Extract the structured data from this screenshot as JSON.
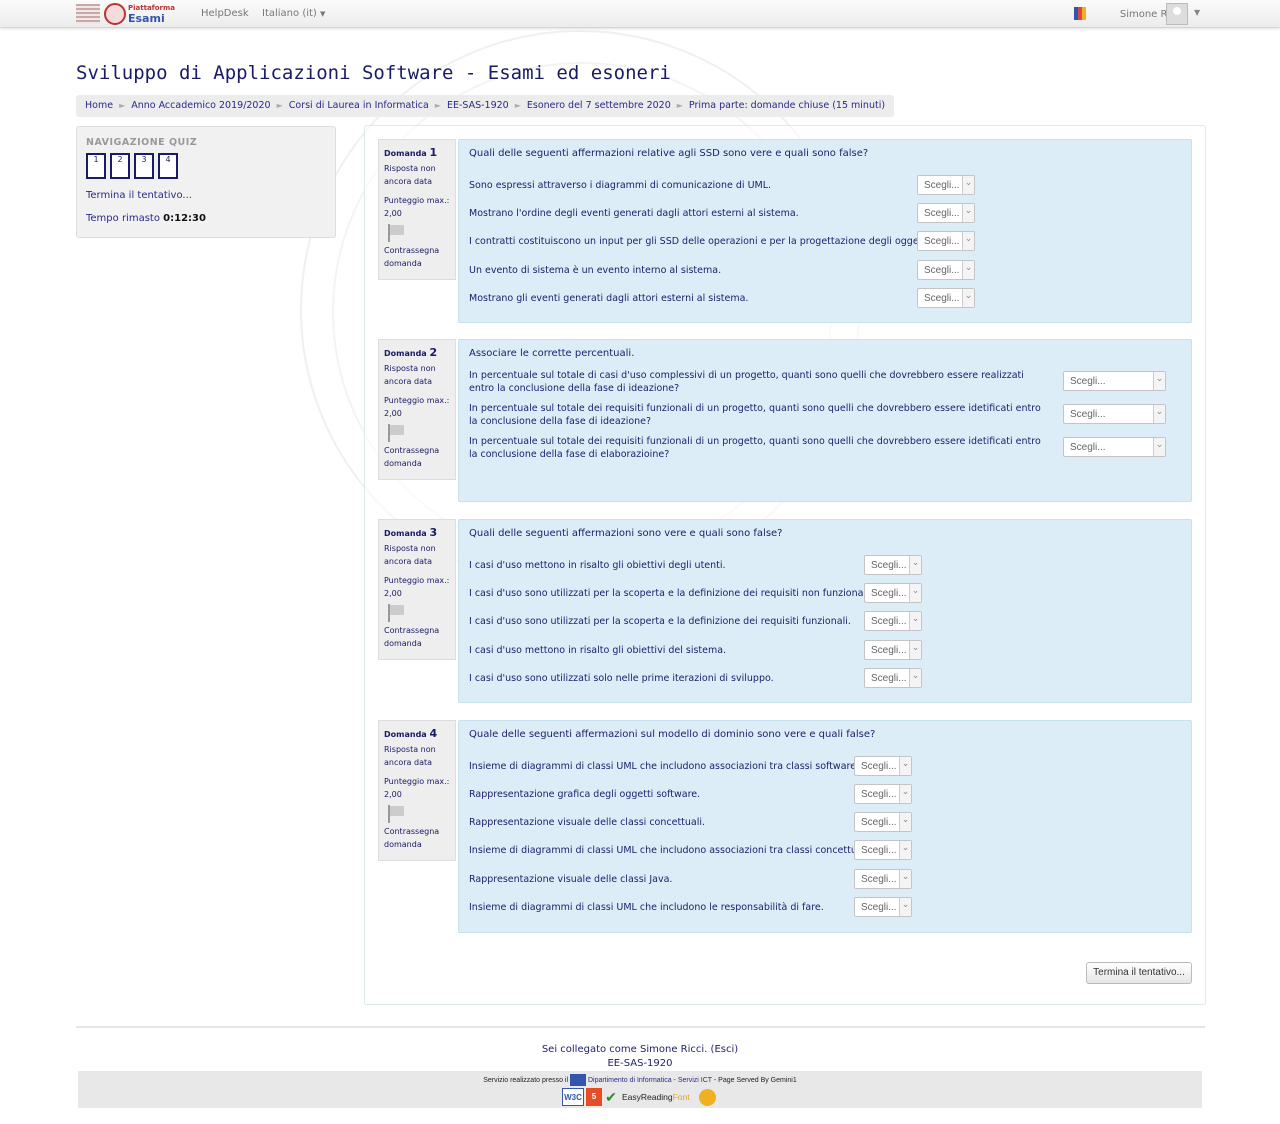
{
  "topbar": {
    "logo_line1": "Piattaforma",
    "logo_line2": "Esami",
    "helpdesk": "HelpDesk",
    "language": "Italiano (it)",
    "user_name": "Simone Ricci"
  },
  "page": {
    "title": "Sviluppo di Applicazioni Software - Esami ed esoneri"
  },
  "breadcrumb": [
    "Home",
    "Anno Accademico 2019/2020",
    "Corsi di Laurea in Informatica",
    "EE-SAS-1920",
    "Esonero del 7 settembre 2020",
    "Prima parte: domande chiuse (15 minuti)"
  ],
  "quiz_nav": {
    "heading": "NAVIGAZIONE QUIZ",
    "buttons": [
      "1",
      "2",
      "3",
      "4"
    ],
    "finish_link": "Termina il tentativo...",
    "time_label": "Tempo rimasto",
    "time_value": "0:12:30"
  },
  "question_info": {
    "label": "Domanda",
    "status": "Risposta non ancora data",
    "score_label": "Punteggio max.:",
    "score": "2,00",
    "flag_label": "Contrassegna domanda"
  },
  "select_placeholder": "Scegli...",
  "questions": [
    {
      "number": "1",
      "text": "Quali delle seguenti affermazioni relative agli SSD sono vere e quali sono false?",
      "rows": [
        "Sono espressi attraverso i diagrammi di comunicazione di UML.",
        "Mostrano l'ordine degli eventi generati dagli attori esterni al sistema.",
        "I contratti costituiscono un input per gli SSD delle operazioni e per la progettazione degli oggetti.",
        "Un evento di sistema è un evento interno al sistema.",
        "Mostrano gli eventi generati dagli attori esterni al sistema."
      ]
    },
    {
      "number": "2",
      "text": "Associare le corrette percentuali.",
      "rows": [
        "In percentuale sul totale di casi d'uso complessivi di un progetto, quanti sono quelli che dovrebbero essere realizzati entro la conclusione della fase di ideazione?",
        "In percentuale sul totale dei requisiti funzionali di un progetto, quanti sono quelli che dovrebbero essere idetificati entro la conclusione della fase di ideazione?",
        "In percentuale sul totale dei requisiti funzionali di un progetto, quanti sono quelli che dovrebbero essere idetificati entro la conclusione della fase di elaborazioine?"
      ]
    },
    {
      "number": "3",
      "text": "Quali delle seguenti affermazioni sono vere e quali sono false?",
      "rows": [
        "I casi d'uso mettono in risalto gli obiettivi degli utenti.",
        "I casi d'uso sono utilizzati per la scoperta e la definizione dei requisiti non funzionali.",
        "I casi d'uso sono utilizzati per la scoperta e la definizione dei requisiti funzionali.",
        "I casi d'uso mettono in risalto gli obiettivi del sistema.",
        "I casi d'uso sono utilizzati solo nelle prime iterazioni di sviluppo."
      ]
    },
    {
      "number": "4",
      "text": "Quale delle seguenti affermazioni sul modello di dominio sono vere e quali false?",
      "rows": [
        "Insieme di diagrammi di classi UML che includono associazioni tra classi software.",
        "Rappresentazione grafica degli oggetti software.",
        "Rappresentazione visuale delle classi concettuali.",
        "Insieme di diagrammi di classi UML che includono associazioni tra classi concettuali.",
        "Rappresentazione visuale delle classi Java.",
        "Insieme di diagrammi di classi UML che includono le responsabilità di fare."
      ]
    }
  ],
  "finish_button": "Termina il tentativo...",
  "footer": {
    "logged_in_prefix": "Sei collegato come",
    "logged_in_user": "Simone Ricci.",
    "logout": "(Esci)",
    "course_code": "EE-SAS-1920",
    "service_prefix": "Servizio realizzato presso il",
    "service_dept": "Dipartimento di Informatica - Servizi ICT",
    "service_suffix": "- Page Served By Gemini1",
    "badge_w3c": "W3C",
    "badge_html": "5",
    "badge_easy": "EasyReading",
    "badge_font": "Font"
  }
}
